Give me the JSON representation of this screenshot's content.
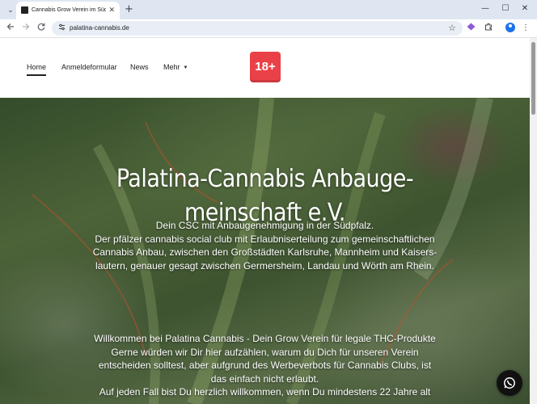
{
  "browser": {
    "tab_title": "Cannabis Grow Verein im Südpfalz",
    "url": "palatina-cannabis.de",
    "tab_close": "✕",
    "new_tab": "+",
    "controls": {
      "dropdown": "⌄",
      "minimize": "—",
      "maximize": "☐",
      "close": "✕"
    }
  },
  "nav": {
    "items": [
      {
        "label": "Home",
        "active": true
      },
      {
        "label": "Anmeldeformular"
      },
      {
        "label": "News"
      },
      {
        "label": "Mehr"
      }
    ],
    "age_badge": "18+"
  },
  "hero": {
    "title_line1": "Palatina-Cannabis Anbauge-",
    "title_line2": "meinschaft e.V.",
    "intro": [
      "Dein CSC mit Anbaugenehmigung in der Südpfalz.",
      "Der pfälzer cannabis social club mit Erlaubniserteilung zum gemeinschaftlichen",
      "Cannabis Anbau, zwischen den Großstädten Karlsruhe, Mannheim und Kaisers-",
      "lautern, genauer gesagt zwischen Germersheim, Landau und Wörth am Rhein."
    ],
    "welcome": [
      "Willkommen bei Palatina Cannabis - Dein Grow Verein für legale THC-Produkte",
      "Gerne würden wir Dir hier aufzählen, warum du Dich für unseren Verein",
      "entscheiden solltest, aber aufgrund des Werbeverbots für Cannabis Clubs, ist",
      "das einfach nicht erlaubt.",
      "Auf jeden Fall bist Du herzlich willkommen, wenn Du mindestens 22 Jahre alt"
    ]
  },
  "icons": {
    "back": "back-arrow-icon",
    "forward": "forward-arrow-icon",
    "reload": "reload-icon",
    "bookmark": "star-icon",
    "whatsapp": "whatsapp-icon"
  }
}
